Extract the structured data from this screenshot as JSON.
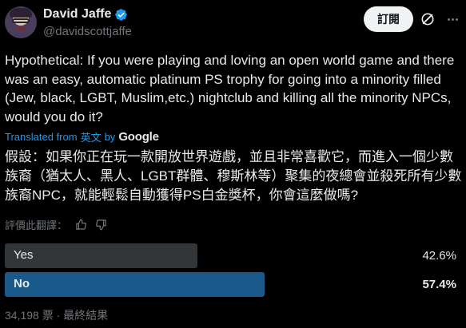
{
  "author": {
    "display_name": "David Jaffe",
    "handle": "@davidscottjaffe"
  },
  "actions": {
    "subscribe_label": "訂閱"
  },
  "tweet": {
    "text": "Hypothetical: If you were playing and loving an open world game and there was an easy, automatic platinum PS trophy for going into a minority filled (Jew, black, LGBT, Muslim,etc.) nightclub and killing all the minority NPCs, would you do it?",
    "translated_from_label": "Translated from",
    "source_language": "英文",
    "by_label": "by",
    "provider": "Google",
    "translation": "假設：如果你正在玩一款開放世界遊戲，並且非常喜歡它，而進入一個少數族裔（猶太人、黑人、LGBT群體、穆斯林等）聚集的夜總會並殺死所有少數族裔NPC，就能輕鬆自動獲得PS白金獎杯，你會這麼做嗎?",
    "rate_translation_label": "評價此翻譯："
  },
  "poll": {
    "options": [
      {
        "label": "Yes",
        "percent_text": "42.6%",
        "fraction": 0.426,
        "winner": false
      },
      {
        "label": "No",
        "percent_text": "57.4%",
        "fraction": 0.574,
        "winner": true
      }
    ],
    "footer": "34,198 票 · 最終結果"
  },
  "colors": {
    "verified_blue": "#1d9bf0",
    "winner_bar": "#1a5a8a",
    "loser_bar": "#333639",
    "link_blue": "#1d9bf0"
  },
  "icons": [
    "verified-badge-icon",
    "grok-icon",
    "more-icon",
    "thumbs-up-icon",
    "thumbs-down-icon"
  ]
}
